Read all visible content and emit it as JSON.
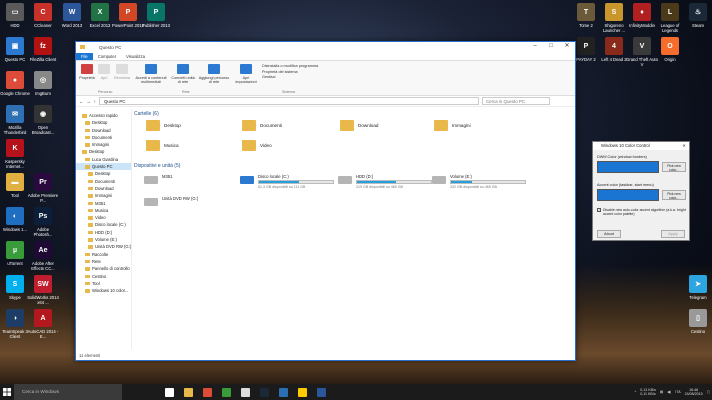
{
  "desktop_icons": [
    {
      "label": "HDD",
      "color": "#5a5a5a",
      "glyph": "▭",
      "col": 0,
      "row": 0
    },
    {
      "label": "CCleaner",
      "color": "#c8302a",
      "glyph": "C",
      "col": 1,
      "row": 0
    },
    {
      "label": "Word 2013",
      "color": "#2b579a",
      "glyph": "W",
      "col": 2,
      "row": 0
    },
    {
      "label": "Excel 2013",
      "color": "#217346",
      "glyph": "X",
      "col": 3,
      "row": 0
    },
    {
      "label": "PowerPoint 2013",
      "color": "#d24726",
      "glyph": "P",
      "col": 4,
      "row": 0
    },
    {
      "label": "Publisher 2013",
      "color": "#077568",
      "glyph": "P",
      "col": 5,
      "row": 0
    },
    {
      "label": "Questo PC",
      "color": "#2b79d1",
      "glyph": "▣",
      "col": 0,
      "row": 1
    },
    {
      "label": "FileZilla Client",
      "color": "#b31212",
      "glyph": "fz",
      "col": 1,
      "row": 1
    },
    {
      "label": "Google Chrome",
      "color": "#dd4b39",
      "glyph": "●",
      "col": 0,
      "row": 2
    },
    {
      "label": "ImgBurn",
      "color": "#888",
      "glyph": "◎",
      "col": 1,
      "row": 2
    },
    {
      "label": "Mozilla Thunderbird",
      "color": "#2f6fb3",
      "glyph": "✉",
      "col": 0,
      "row": 3
    },
    {
      "label": "Open Broadcast...",
      "color": "#333",
      "glyph": "◉",
      "col": 1,
      "row": 3
    },
    {
      "label": "Kaspersky Internet...",
      "color": "#b5121b",
      "glyph": "K",
      "col": 0,
      "row": 4
    },
    {
      "label": "Tool",
      "color": "#e0b040",
      "glyph": "▬",
      "col": 0,
      "row": 5
    },
    {
      "label": "Adobe Premiere P...",
      "color": "#2a0a3e",
      "glyph": "Pr",
      "col": 1,
      "row": 5
    },
    {
      "label": "Windows 1...",
      "color": "#1e6fbf",
      "glyph": "◐",
      "col": 0,
      "row": 6
    },
    {
      "label": "Adobe Photosh...",
      "color": "#0b1f3a",
      "glyph": "Ps",
      "col": 1,
      "row": 6
    },
    {
      "label": "uTorrent",
      "color": "#3a9b3a",
      "glyph": "µ",
      "col": 0,
      "row": 7
    },
    {
      "label": "Adobe After Effects CC...",
      "color": "#1f0a36",
      "glyph": "Ae",
      "col": 1,
      "row": 7
    },
    {
      "label": "Skype",
      "color": "#00aff0",
      "glyph": "S",
      "col": 0,
      "row": 8
    },
    {
      "label": "SolidWorks 2014 x64 ...",
      "color": "#c01e2e",
      "glyph": "SW",
      "col": 1,
      "row": 8
    },
    {
      "label": "TeamSpeak 3 Client",
      "color": "#1d3d66",
      "glyph": "◑",
      "col": 0,
      "row": 9
    },
    {
      "label": "AutoCAD 2014 - E...",
      "color": "#b3181e",
      "glyph": "A",
      "col": 1,
      "row": 9
    },
    {
      "label": "Tome 2",
      "color": "#6a5a3a",
      "glyph": "T",
      "col": "r4",
      "row": 0
    },
    {
      "label": "Shigoreno Launcher ...",
      "color": "#c8962a",
      "glyph": "S",
      "col": "r3",
      "row": 0
    },
    {
      "label": "InfinityModdin",
      "color": "#b02020",
      "glyph": "♦",
      "col": "r2",
      "row": 0
    },
    {
      "label": "League of Legends",
      "color": "#4a3a1a",
      "glyph": "L",
      "col": "r1",
      "row": 0
    },
    {
      "label": "Steam",
      "color": "#1b2838",
      "glyph": "♨",
      "col": "r0",
      "row": 0
    },
    {
      "label": "PAYDAY 2",
      "color": "#222",
      "glyph": "P",
      "col": "r4",
      "row": 1
    },
    {
      "label": "Left 4 Dead 2",
      "color": "#8a2a1a",
      "glyph": "4",
      "col": "r3",
      "row": 1
    },
    {
      "label": "Grand Theft Auto V",
      "color": "#3a3a3a",
      "glyph": "V",
      "col": "r2",
      "row": 1
    },
    {
      "label": "Origin",
      "color": "#f56c2d",
      "glyph": "O",
      "col": "r1",
      "row": 1
    },
    {
      "label": "Telegram",
      "color": "#2ca5e0",
      "glyph": "➤",
      "col": "r0",
      "row": 8
    },
    {
      "label": "Cestino",
      "color": "#999",
      "glyph": "▯",
      "col": "r0",
      "row": 9
    }
  ],
  "explorer": {
    "title": "Questo PC",
    "tabs": [
      "File",
      "Computer",
      "Visualizza"
    ],
    "ribbon": {
      "buttons": [
        "Proprietà",
        "Apri",
        "Rinomina",
        "Accedi a contenuti multimediali",
        "Connetti unità di rete",
        "Aggiungi percorso di rete",
        "Apri impostazioni"
      ],
      "system_items": [
        "Disinstalla o modifica programma",
        "Proprietà del sistema",
        "Gestisci"
      ],
      "groups": [
        "Percorso",
        "Rete",
        "Sistema"
      ]
    },
    "address": "Questo PC",
    "search_placeholder": "Cerca in Questo PC",
    "nav_items": [
      "Accesso rapido",
      "Desktop",
      "Download",
      "Documenti",
      "Immagini",
      "Desktop",
      "Luca Giardina",
      "Questo PC",
      "Desktop",
      "Documenti",
      "Download",
      "Immagini",
      "M351",
      "Musica",
      "Video",
      "Disco locale (C:)",
      "HDD (D:)",
      "Volume (E:)",
      "Unità DVD RW (G:)",
      "Raccolte",
      "Rete",
      "Pannello di controllo",
      "Cestino",
      "Tool",
      "Windows 10 color..."
    ],
    "folders_header": "Cartelle (6)",
    "folders": [
      "Desktop",
      "Documenti",
      "Download",
      "Immagini",
      "Musica",
      "Video"
    ],
    "devices_header": "Dispositivi e unità (5)",
    "devices": [
      {
        "name": "M351",
        "sub": "",
        "fill": 0
      },
      {
        "name": "Disco locale (C:)",
        "sub": "51,3 GB disponibili su 111 GB",
        "fill": 0.54
      },
      {
        "name": "HDD (D:)",
        "sub": "219 GB disponibili su 465 GB",
        "fill": 0.53
      },
      {
        "name": "Volume (E:)",
        "sub": "332 GB disponibili su 465 GB",
        "fill": 0.29
      },
      {
        "name": "Unità DVD RW (G:)",
        "sub": "",
        "fill": 0
      }
    ],
    "status": "11 elementi"
  },
  "color_control": {
    "title": "Windows 10 Color Control",
    "dwm_label": "DWM Color (window borders)",
    "accent_label": "Accent color (taskbar, start menu)",
    "pick_label": "Pick new color...",
    "checkbox_label": "Disable new auto-color accent algorithm (a.k.a. bright accent color palette)",
    "about": "About",
    "apply": "Apply",
    "swatch_color": "#1a74d1"
  },
  "taskbar": {
    "search_placeholder": "Cerca in Windows",
    "apps": [
      "#ffffff",
      "#e8b84a",
      "#dd4b39",
      "#3a9b3a",
      "#ddd",
      "#1b2838",
      "#2b6fb3",
      "#ffcc00",
      "#2b579a"
    ],
    "net_up": "0,13 KB/s",
    "net_down": "0,11 KB/s",
    "time": "16:48",
    "date": "24/08/2015",
    "lang": "ITA"
  }
}
